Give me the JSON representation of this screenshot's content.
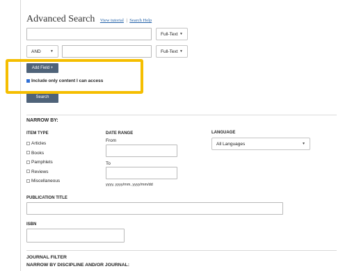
{
  "header": {
    "title": "Advanced Search",
    "view_tutorial": "View tutorial",
    "separator": "|",
    "search_help": "Search Help"
  },
  "row1": {
    "query_value": "",
    "field_select": "Full-Text"
  },
  "row2": {
    "operator": "AND",
    "query_value": "",
    "field_select": "Full-Text"
  },
  "add_field_label": "Add Field +",
  "include_only": {
    "label": "Include only content I can access",
    "checked": true
  },
  "search_button": "Search",
  "narrow_by": {
    "heading": "NARROW BY:",
    "item_type": {
      "heading": "ITEM TYPE",
      "items": [
        "Articles",
        "Books",
        "Pamphlets",
        "Reviews",
        "Miscellaneous"
      ]
    },
    "date_range": {
      "heading": "DATE RANGE",
      "from_label": "From",
      "to_label": "To",
      "hint": "yyyy, yyyy/mm, yyyy/mm/dd"
    },
    "language": {
      "heading": "LANGUAGE",
      "selected": "All Languages"
    }
  },
  "publication_title": {
    "label": "PUBLICATION TITLE",
    "value": ""
  },
  "isbn": {
    "label": "ISBN",
    "value": ""
  },
  "journal_filter": {
    "heading": "JOURNAL FILTER",
    "subheading": "NARROW BY DISCIPLINE AND/OR JOURNAL:"
  },
  "colors": {
    "highlight": "#f5be00",
    "button": "#4f6379",
    "link": "#1f5fa6"
  }
}
